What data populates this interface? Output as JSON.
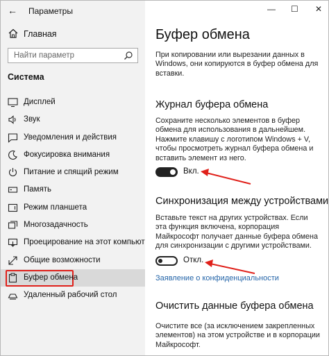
{
  "window": {
    "title": "Параметры",
    "controls": {
      "minimize": "—",
      "maximize": "☐",
      "close": "✕"
    }
  },
  "sidebar": {
    "home_label": "Главная",
    "search_placeholder": "Найти параметр",
    "section_title": "Система",
    "items": [
      {
        "label": "Дисплей",
        "icon": "display-icon"
      },
      {
        "label": "Звук",
        "icon": "sound-icon"
      },
      {
        "label": "Уведомления и действия",
        "icon": "notifications-icon"
      },
      {
        "label": "Фокусировка внимания",
        "icon": "focus-assist-icon"
      },
      {
        "label": "Питание и спящий режим",
        "icon": "power-icon"
      },
      {
        "label": "Память",
        "icon": "storage-icon"
      },
      {
        "label": "Режим планшета",
        "icon": "tablet-mode-icon"
      },
      {
        "label": "Многозадачность",
        "icon": "multitasking-icon"
      },
      {
        "label": "Проецирование на этот компьютер",
        "icon": "projecting-icon"
      },
      {
        "label": "Общие возможности",
        "icon": "shared-experiences-icon"
      },
      {
        "label": "Буфер обмена",
        "icon": "clipboard-icon",
        "active": true
      },
      {
        "label": "Удаленный рабочий стол",
        "icon": "remote-desktop-icon"
      }
    ]
  },
  "main": {
    "title": "Буфер обмена",
    "intro": "При копировании или вырезании данных в Windows, они копируются в буфер обмена для вставки.",
    "history": {
      "heading": "Журнал буфера обмена",
      "description": "Сохраните несколько элементов в буфер обмена для использования в дальнейшем. Нажмите клавишу с логотипом Windows + V, чтобы просмотреть журнал буфера обмена и вставить элемент из него.",
      "toggle_label": "Вкл.",
      "toggle_on": true
    },
    "sync": {
      "heading": "Синхронизация между устройствами",
      "description": "Вставьте текст на других устройствах. Если эта функция включена, корпорация Майкрософт получает данные буфера обмена для синхронизации с другими устройствами.",
      "toggle_label": "Откл.",
      "toggle_on": false,
      "privacy_link": "Заявление о конфиденциальности"
    },
    "clear": {
      "heading": "Очистить данные буфера обмена",
      "description": "Очистите все (за исключением закрепленных элементов) на этом устройстве и в корпорации Майкрософт."
    }
  },
  "colors": {
    "sidebar_bg": "#f2f2f2",
    "active_item_bg": "#d9d9d9",
    "highlight_red": "#e0201a",
    "link_blue": "#2364a8"
  }
}
